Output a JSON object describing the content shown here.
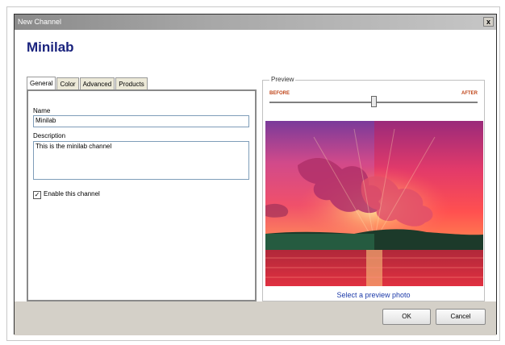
{
  "window": {
    "title": "New Channel",
    "close_label": "x"
  },
  "header": {
    "title": "Minilab"
  },
  "tabs": [
    {
      "label": "General",
      "active": true
    },
    {
      "label": "Color",
      "active": false
    },
    {
      "label": "Advanced",
      "active": false
    },
    {
      "label": "Products",
      "active": false
    }
  ],
  "general": {
    "name_label": "Name",
    "name_value": "Minilab",
    "description_label": "Description",
    "description_value": "This is the minilab channel",
    "enable_checked": true,
    "enable_label": "Enable this channel"
  },
  "preview": {
    "legend": "Preview",
    "before_label": "BEFORE",
    "after_label": "AFTER",
    "slider_value": 0.5,
    "select_link": "Select a preview photo"
  },
  "footer": {
    "ok_label": "OK",
    "cancel_label": "Cancel"
  },
  "colors": {
    "title": "#1a237e",
    "before_after": "#c0461a",
    "link": "#1c3aa9"
  }
}
